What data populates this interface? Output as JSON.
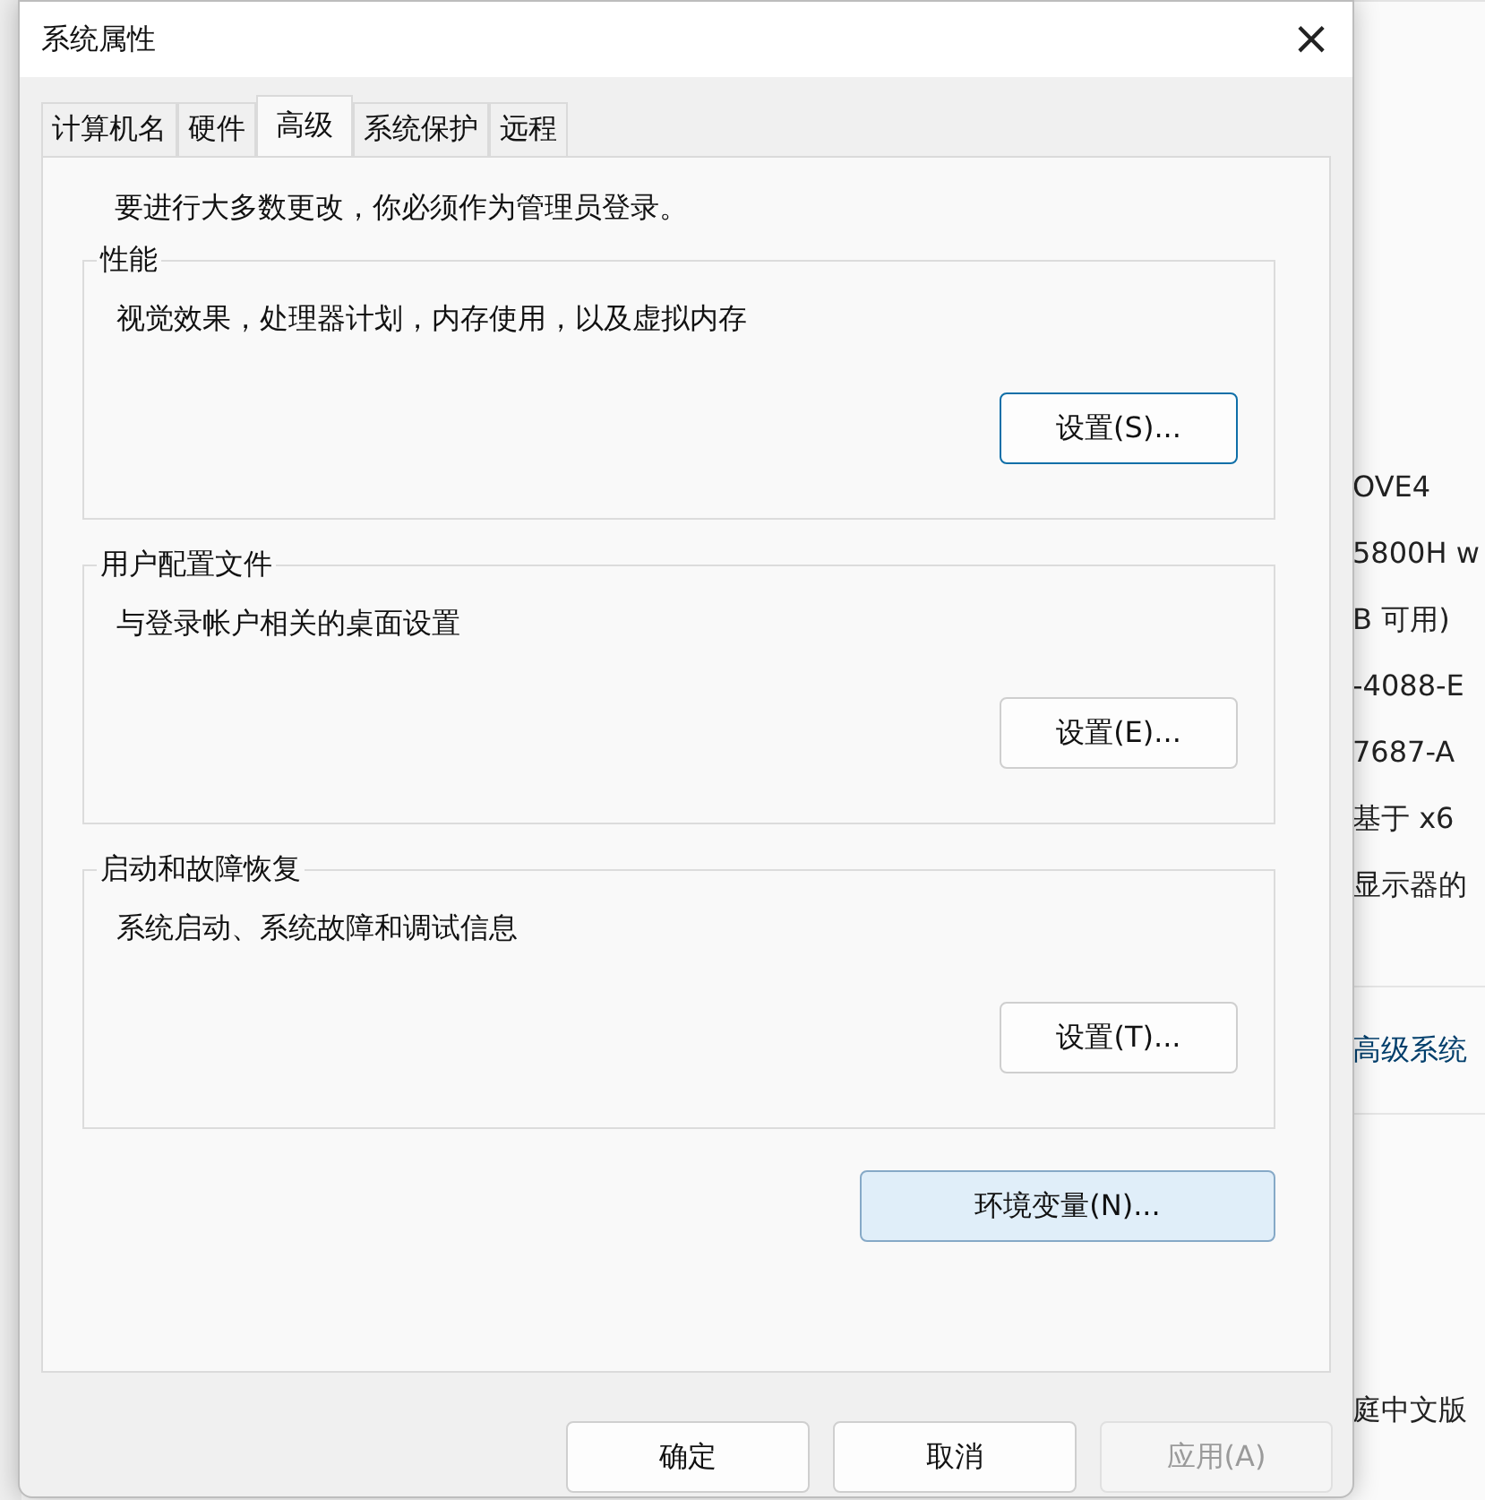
{
  "background_window": {
    "lines": [
      {
        "text": "OVE4",
        "kind": "info"
      },
      {
        "text": "5800H w",
        "kind": "info"
      },
      {
        "text": "B 可用)",
        "kind": "info"
      },
      {
        "text": "-4088-E",
        "kind": "info"
      },
      {
        "text": "7687-A",
        "kind": "info"
      },
      {
        "text": "基于 x6",
        "kind": "info"
      },
      {
        "text": "显示器的",
        "kind": "info"
      },
      {
        "text": "高级系统",
        "kind": "link"
      },
      {
        "text": "庭中文版",
        "kind": "info"
      }
    ]
  },
  "window": {
    "title": "系统属性",
    "close": "×"
  },
  "tabs": [
    {
      "label": "计算机名",
      "selected": false
    },
    {
      "label": "硬件",
      "selected": false
    },
    {
      "label": "高级",
      "selected": true
    },
    {
      "label": "系统保护",
      "selected": false
    },
    {
      "label": "远程",
      "selected": false
    }
  ],
  "notice": "要进行大多数更改，你必须作为管理员登录。",
  "groups": [
    {
      "title": "性能",
      "description": "视觉效果，处理器计划，内存使用，以及虚拟内存",
      "button": "设置(S)...",
      "focused": true
    },
    {
      "title": "用户配置文件",
      "description": "与登录帐户相关的桌面设置",
      "button": "设置(E)...",
      "focused": false
    },
    {
      "title": "启动和故障恢复",
      "description": "系统启动、系统故障和调试信息",
      "button": "设置(T)...",
      "focused": false
    }
  ],
  "env_button": "环境变量(N)...",
  "buttons": [
    {
      "label": "确定",
      "disabled": false
    },
    {
      "label": "取消",
      "disabled": false
    },
    {
      "label": "应用(A)",
      "disabled": true
    }
  ]
}
